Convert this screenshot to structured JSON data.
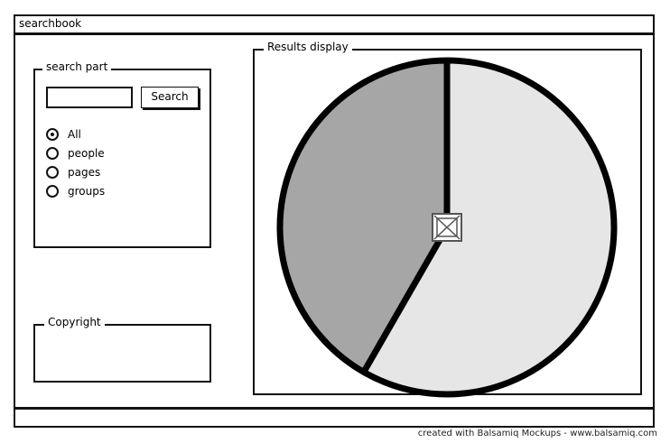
{
  "window": {
    "title": "searchbook"
  },
  "search_panel": {
    "legend": "search part",
    "input_value": "",
    "search_label": "Search",
    "options": [
      {
        "label": "All",
        "checked": true
      },
      {
        "label": "people",
        "checked": false
      },
      {
        "label": "pages",
        "checked": false
      },
      {
        "label": "groups",
        "checked": false
      }
    ]
  },
  "copyright_panel": {
    "legend": "Copyright"
  },
  "results_panel": {
    "legend": "Results display",
    "pie_chart": {
      "slices": [
        {
          "share": 0.583,
          "color": "#e6e6e6"
        },
        {
          "share": 0.417,
          "color": "#a6a6a6"
        }
      ],
      "center_icon": "image-placeholder-icon"
    }
  },
  "footer": {
    "credit": "created with Balsamiq Mockups - www.balsamiq.com"
  }
}
